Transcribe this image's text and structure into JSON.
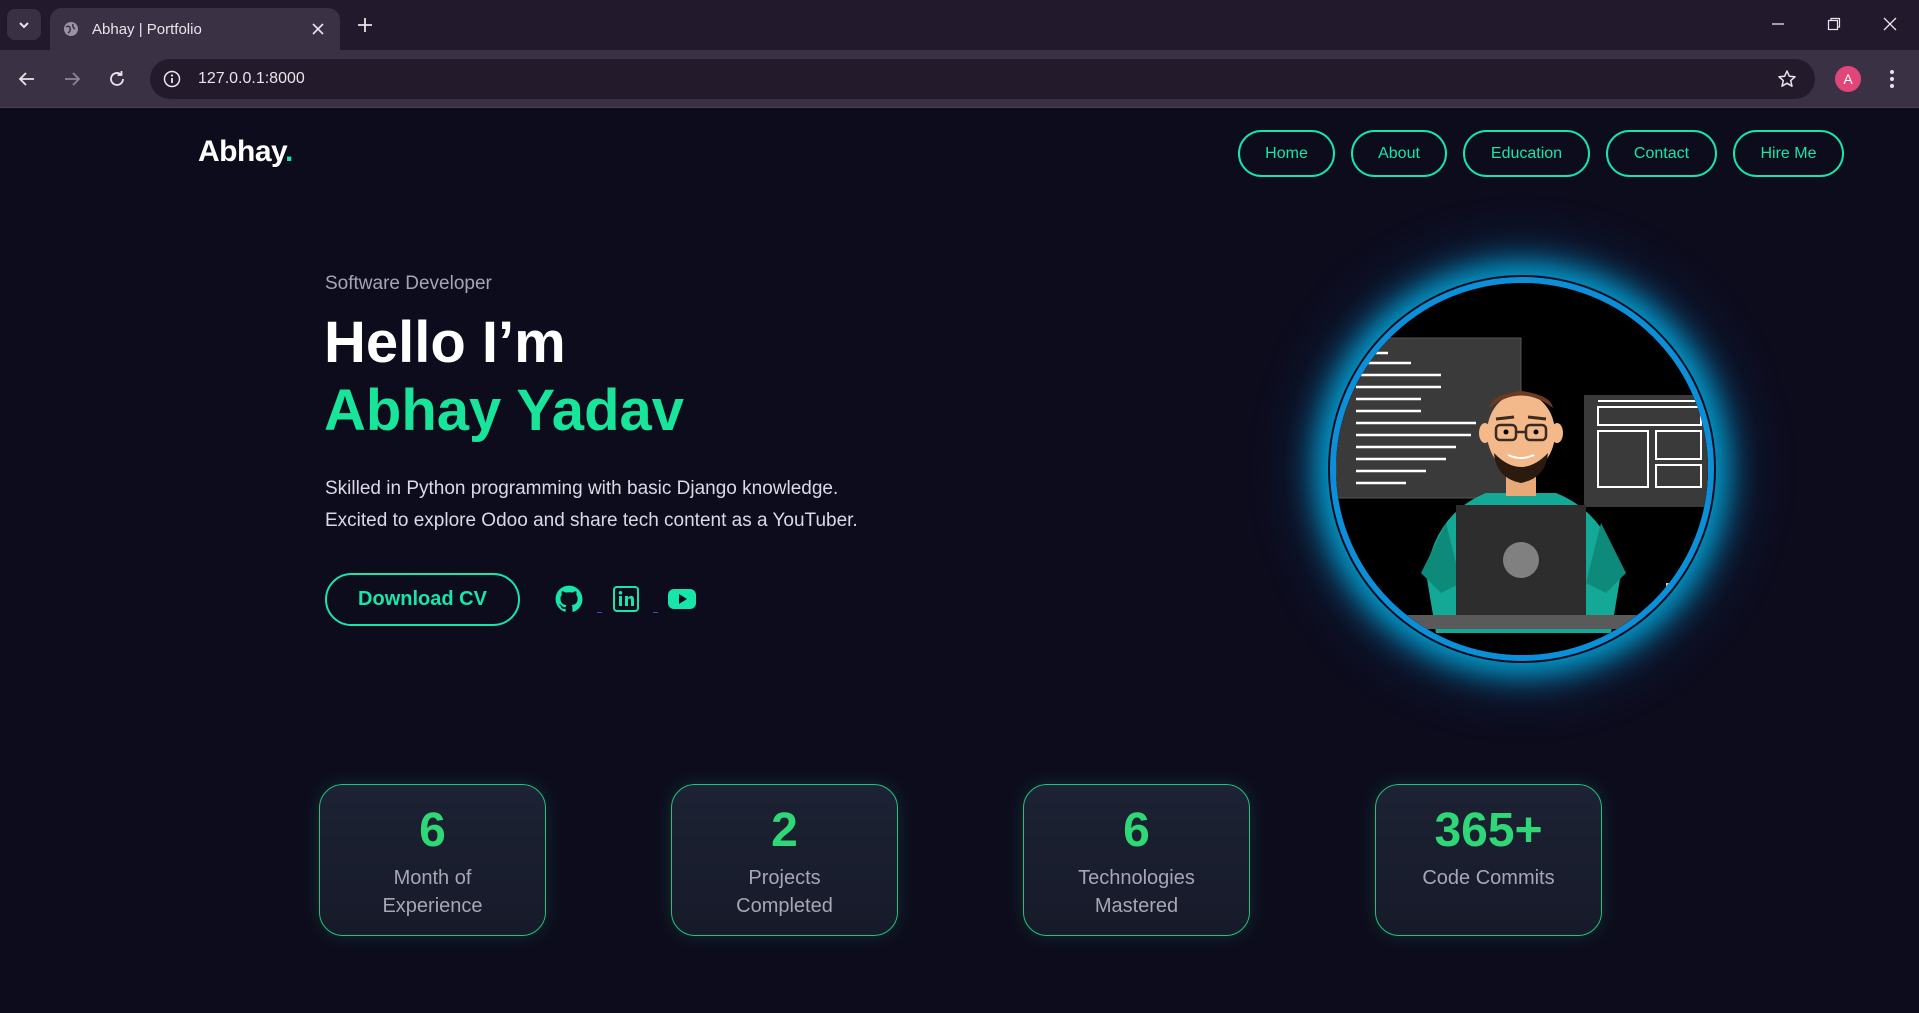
{
  "browser": {
    "tab_title": "Abhay | Portfolio",
    "url": "127.0.0.1:8000",
    "profile_initial": "A"
  },
  "site": {
    "logo": "Abhay",
    "logo_dot": ".",
    "nav": [
      "Home",
      "About",
      "Education",
      "Contact",
      "Hire Me"
    ]
  },
  "hero": {
    "subtitle": "Software Developer",
    "greeting": "Hello I’m",
    "name": "Abhay Yadav",
    "description_line1": "Skilled in Python programming with basic Django knowledge.",
    "description_line2": "Excited to explore Odoo and share tech content as a YouTuber.",
    "cv_button": "Download CV",
    "social_icons": [
      "github-icon",
      "linkedin-icon",
      "youtube-icon"
    ]
  },
  "stats": [
    {
      "value": "6",
      "label": "Month of Experience"
    },
    {
      "value": "2",
      "label": "Projects Completed"
    },
    {
      "value": "6",
      "label": "Technologies Mastered"
    },
    {
      "value": "365+",
      "label": "Code Commits"
    }
  ],
  "colors": {
    "accent": "#18e5a8",
    "name_green": "#18e59a",
    "stat_green": "#2fd877",
    "page_bg": "#0d0c1d",
    "glow": "#00c8ff"
  }
}
